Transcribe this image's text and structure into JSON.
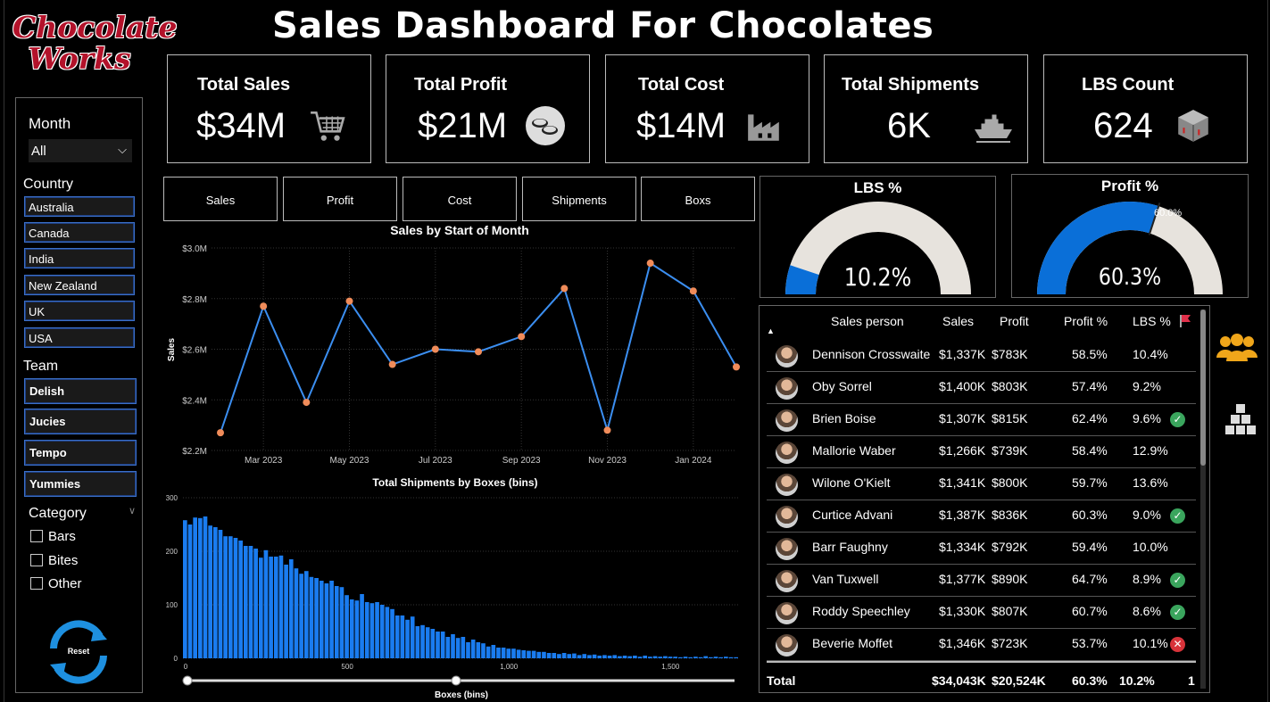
{
  "logo": {
    "line1": "Chocolate",
    "line2": "Works"
  },
  "title": "Sales Dashboard For Chocolates",
  "kpis": [
    {
      "title": "Total Sales",
      "value": "$34M",
      "icon": "cart-icon"
    },
    {
      "title": "Total Profit",
      "value": "$21M",
      "icon": "coins-icon"
    },
    {
      "title": "Total Cost",
      "value": "$14M",
      "icon": "factory-icon"
    },
    {
      "title": "Total Shipments",
      "value": "6K",
      "icon": "ship-icon"
    },
    {
      "title": "LBS Count",
      "value": "624",
      "icon": "box-icon"
    }
  ],
  "slicer": {
    "month_label": "Month",
    "month_value": "All",
    "country_label": "Country",
    "countries": [
      "Australia",
      "Canada",
      "India",
      "New Zealand",
      "UK",
      "USA"
    ],
    "team_label": "Team",
    "teams": [
      "Delish",
      "Jucies",
      "Tempo",
      "Yummies"
    ],
    "category_label": "Category",
    "categories": [
      "Bars",
      "Bites",
      "Other"
    ],
    "reset_label": "Reset"
  },
  "tabs": [
    "Sales",
    "Profit",
    "Cost",
    "Shipments",
    "Boxs"
  ],
  "gauges": [
    {
      "title": "LBS %",
      "value_label": "10.2%",
      "fraction": 0.102,
      "fill": "#0a6fd8"
    },
    {
      "title": "Profit %",
      "value_label": "60.3%",
      "fraction": 0.603,
      "target_label": "60.0%",
      "fill": "#0a6fd8"
    }
  ],
  "colors": {
    "accent": "#1a7cf0",
    "line": "#3b8ef0",
    "marker": "#f08c5a",
    "track": "#e7e3dd",
    "ok": "#3aa55d",
    "bad": "#d8333a"
  },
  "chart_data": [
    {
      "type": "line",
      "title": "Sales by Start of Month",
      "ylabel": "Sales",
      "xlabel": "",
      "x": [
        "Feb 2023",
        "Mar 2023",
        "Apr 2023",
        "May 2023",
        "Jun 2023",
        "Jul 2023",
        "Aug 2023",
        "Sep 2023",
        "Oct 2023",
        "Nov 2023",
        "Dec 2023",
        "Jan 2024",
        "Feb 2024"
      ],
      "x_tick_labels": [
        "Mar 2023",
        "May 2023",
        "Jul 2023",
        "Sep 2023",
        "Nov 2023",
        "Jan 2024"
      ],
      "values": [
        2.27,
        2.77,
        2.39,
        2.79,
        2.54,
        2.6,
        2.59,
        2.65,
        2.84,
        2.28,
        2.94,
        2.83,
        2.53
      ],
      "y_unit": "$M",
      "ylim": [
        2.2,
        3.0
      ],
      "y_tick_labels": [
        "$2.2M",
        "$2.4M",
        "$2.6M",
        "$2.8M",
        "$3.0M"
      ],
      "y_ticks": [
        2.2,
        2.4,
        2.6,
        2.8,
        3.0
      ],
      "grid": true
    },
    {
      "type": "bar",
      "title": "Total Shipments by Boxes (bins)",
      "xlabel": "Boxes (bins)",
      "ylabel": "",
      "x_start": 0,
      "x_end": 1720,
      "x_ticks": [
        0,
        500,
        1000,
        1500
      ],
      "x_tick_labels": [
        "0",
        "500",
        "1,000",
        "1,500"
      ],
      "ylim": [
        0,
        300
      ],
      "y_ticks": [
        0,
        100,
        200,
        300
      ],
      "y_tick_labels": [
        "0",
        "100",
        "200",
        "300"
      ],
      "values": [
        258,
        250,
        263,
        262,
        265,
        248,
        245,
        240,
        228,
        228,
        225,
        220,
        210,
        210,
        205,
        188,
        202,
        190,
        190,
        192,
        175,
        185,
        168,
        158,
        163,
        152,
        150,
        145,
        140,
        145,
        135,
        133,
        118,
        110,
        108,
        120,
        105,
        103,
        105,
        100,
        96,
        92,
        80,
        80,
        72,
        78,
        60,
        62,
        58,
        55,
        50,
        50,
        40,
        45,
        38,
        40,
        30,
        35,
        30,
        28,
        22,
        25,
        20,
        20,
        18,
        18,
        16,
        15,
        14,
        14,
        12,
        12,
        10,
        10,
        8,
        10,
        8,
        9,
        6,
        8,
        6,
        7,
        5,
        6,
        5,
        6,
        4,
        5,
        4,
        5,
        3,
        5,
        3,
        4,
        3,
        4,
        3,
        3,
        2,
        3,
        2,
        3,
        2,
        4,
        2,
        3,
        2,
        3,
        2,
        2
      ]
    }
  ],
  "table": {
    "headers": {
      "person": "Sales person",
      "sales": "Sales",
      "profit": "Profit",
      "profit_pct": "Profit %",
      "lbs_pct": "LBS %"
    },
    "rows": [
      {
        "name": "Dennison Crosswaite",
        "sales": "$1,337K",
        "profit": "$783K",
        "profit_pct": "58.5%",
        "lbs_pct": "10.4%",
        "status": ""
      },
      {
        "name": "Oby Sorrel",
        "sales": "$1,400K",
        "profit": "$803K",
        "profit_pct": "57.4%",
        "lbs_pct": "9.2%",
        "status": ""
      },
      {
        "name": "Brien Boise",
        "sales": "$1,307K",
        "profit": "$815K",
        "profit_pct": "62.4%",
        "lbs_pct": "9.6%",
        "status": "ok"
      },
      {
        "name": "Mallorie Waber",
        "sales": "$1,266K",
        "profit": "$739K",
        "profit_pct": "58.4%",
        "lbs_pct": "12.9%",
        "status": ""
      },
      {
        "name": "Wilone O'Kielt",
        "sales": "$1,341K",
        "profit": "$800K",
        "profit_pct": "59.7%",
        "lbs_pct": "13.6%",
        "status": ""
      },
      {
        "name": "Curtice Advani",
        "sales": "$1,387K",
        "profit": "$836K",
        "profit_pct": "60.3%",
        "lbs_pct": "9.0%",
        "status": "ok"
      },
      {
        "name": "Barr Faughny",
        "sales": "$1,334K",
        "profit": "$792K",
        "profit_pct": "59.4%",
        "lbs_pct": "10.0%",
        "status": ""
      },
      {
        "name": "Van Tuxwell",
        "sales": "$1,377K",
        "profit": "$890K",
        "profit_pct": "64.7%",
        "lbs_pct": "8.9%",
        "status": "ok"
      },
      {
        "name": "Roddy Speechley",
        "sales": "$1,330K",
        "profit": "$807K",
        "profit_pct": "60.7%",
        "lbs_pct": "8.6%",
        "status": "ok"
      },
      {
        "name": "Beverie Moffet",
        "sales": "$1,346K",
        "profit": "$723K",
        "profit_pct": "53.7%",
        "lbs_pct": "10.1%",
        "status": "bad"
      }
    ],
    "total": {
      "label": "Total",
      "sales": "$34,043K",
      "profit": "$20,524K",
      "profit_pct": "60.3%",
      "lbs_pct": "10.2%",
      "count": "1"
    }
  },
  "side_icons": [
    "people-icon",
    "stacked-boxes-icon"
  ]
}
